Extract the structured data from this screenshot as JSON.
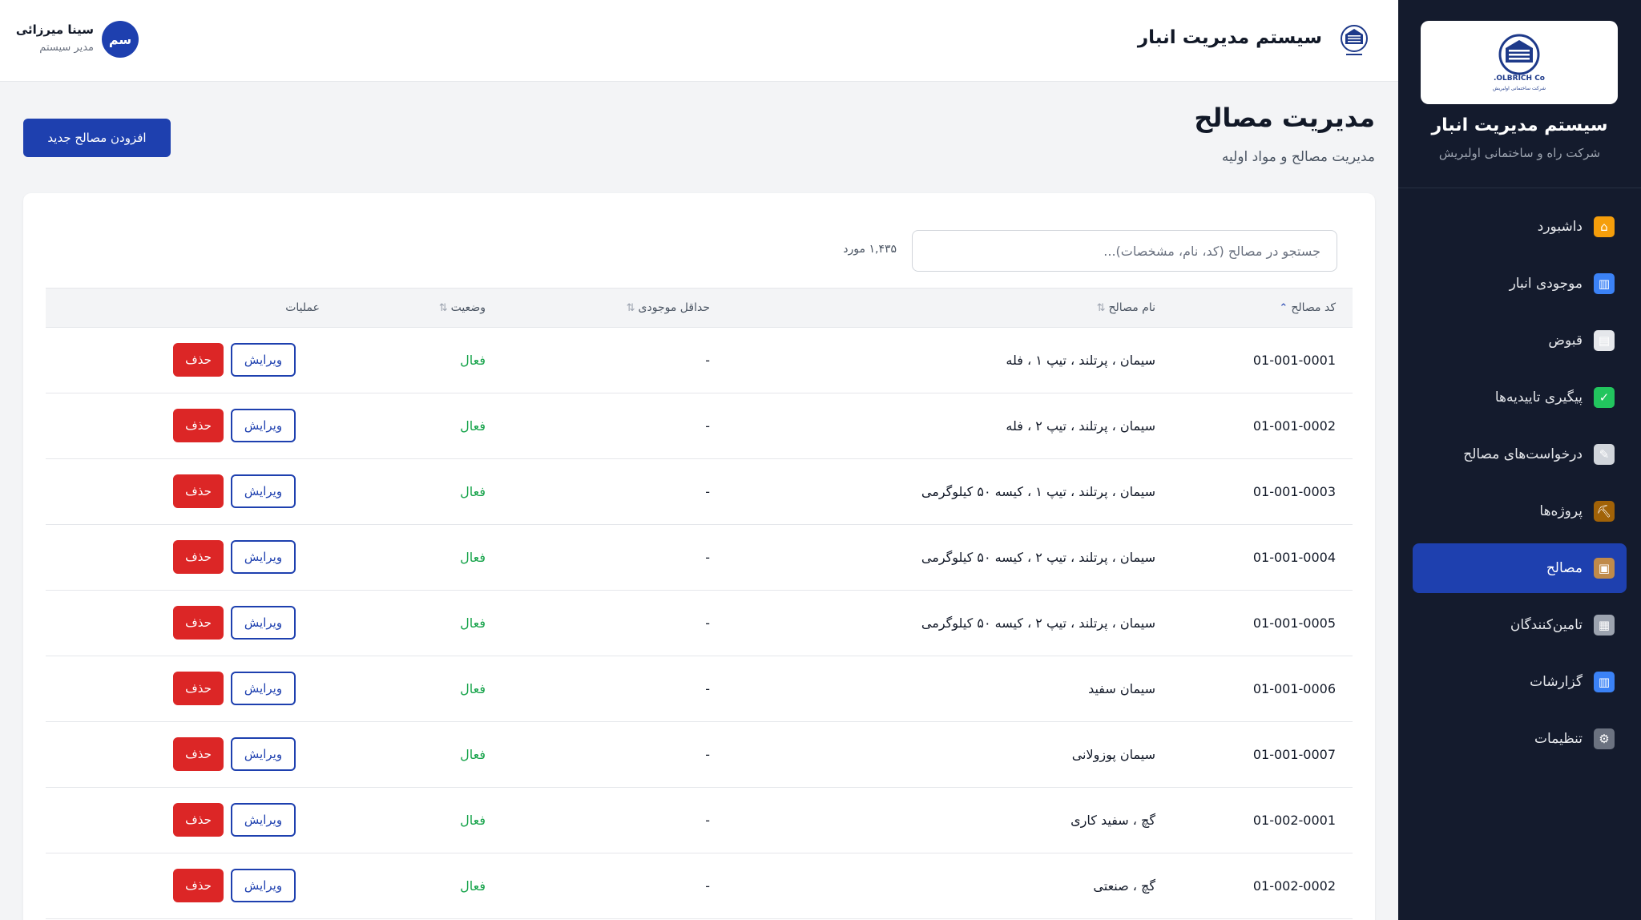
{
  "topbar": {
    "title": "سیستم مدیریت انبار",
    "user": {
      "initials": "سم",
      "name": "سینا میرزائی",
      "role": "مدیر سیستم"
    }
  },
  "sidebar": {
    "logo_caption": "شرکت ساختمانی اولبریش",
    "logo_brand": "OLBRICH Co.",
    "title": "سیستم مدیریت انبار",
    "subtitle": "شرکت راه و ساختمانی اولبریش",
    "items": [
      {
        "label": "داشبورد",
        "icon": "home-icon",
        "glyph": "⌂",
        "color": "#f59e0b",
        "active": false
      },
      {
        "label": "موجودی انبار",
        "icon": "bar-chart-icon",
        "glyph": "▥",
        "color": "#3b82f6",
        "active": false
      },
      {
        "label": "قبوض",
        "icon": "document-icon",
        "glyph": "▤",
        "color": "#e5e7eb",
        "active": false
      },
      {
        "label": "پیگیری تاییدیه‌ها",
        "icon": "check-icon",
        "glyph": "✓",
        "color": "#22c55e",
        "active": false
      },
      {
        "label": "درخواست‌های مصالح",
        "icon": "memo-icon",
        "glyph": "✎",
        "color": "#d1d5db",
        "active": false
      },
      {
        "label": "پروژه‌ها",
        "icon": "crane-icon",
        "glyph": "⛏",
        "color": "#a16207",
        "active": false
      },
      {
        "label": "مصالح",
        "icon": "box-icon",
        "glyph": "▣",
        "color": "#c08a4a",
        "active": true
      },
      {
        "label": "تامین‌کنندگان",
        "icon": "building-icon",
        "glyph": "▦",
        "color": "#9ca3af",
        "active": false
      },
      {
        "label": "گزارشات",
        "icon": "bar-chart-icon",
        "glyph": "▥",
        "color": "#3b82f6",
        "active": false
      },
      {
        "label": "تنظیمات",
        "icon": "gear-icon",
        "glyph": "⚙",
        "color": "#6b7280",
        "active": false
      }
    ]
  },
  "page": {
    "title": "مدیریت مصالح",
    "subtitle": "مدیریت مصالح و مواد اولیه",
    "add_button": "افزودن مصالح جدید"
  },
  "search": {
    "placeholder": "جستجو در مصالح (کد، نام، مشخصات)...",
    "count": "۱,۴۳۵ مورد"
  },
  "table": {
    "columns": {
      "code": "کد مصالح",
      "name": "نام مصالح",
      "min_stock": "حداقل موجودی",
      "status": "وضعیت",
      "actions": "عملیات"
    },
    "edit_label": "ویرایش",
    "delete_label": "حذف",
    "rows": [
      {
        "code": "01-001-0001",
        "name": "سیمان ، پرتلند ، تیپ ۱ ، فله",
        "min_stock": "-",
        "status": "فعال"
      },
      {
        "code": "01-001-0002",
        "name": "سیمان ، پرتلند ، تیپ ۲ ، فله",
        "min_stock": "-",
        "status": "فعال"
      },
      {
        "code": "01-001-0003",
        "name": "سیمان ، پرتلند ، تیپ ۱ ، کیسه ۵۰ کیلوگرمی",
        "min_stock": "-",
        "status": "فعال"
      },
      {
        "code": "01-001-0004",
        "name": "سیمان ، پرتلند ، تیپ ۲ ، کیسه ۵۰ کیلوگرمی",
        "min_stock": "-",
        "status": "فعال"
      },
      {
        "code": "01-001-0005",
        "name": "سیمان ، پرتلند ، تیپ ۲ ، کیسه ۵۰ کیلوگرمی",
        "min_stock": "-",
        "status": "فعال"
      },
      {
        "code": "01-001-0006",
        "name": "سیمان سفید",
        "min_stock": "-",
        "status": "فعال"
      },
      {
        "code": "01-001-0007",
        "name": "سیمان پوزولانی",
        "min_stock": "-",
        "status": "فعال"
      },
      {
        "code": "01-002-0001",
        "name": "گچ ، سفید کاری",
        "min_stock": "-",
        "status": "فعال"
      },
      {
        "code": "01-002-0002",
        "name": "گچ ، صنعتی",
        "min_stock": "-",
        "status": "فعال"
      }
    ]
  },
  "colors": {
    "primary": "#1e40af",
    "danger": "#dc2626",
    "success": "#16a34a",
    "sidebar_bg": "#141b2d"
  }
}
